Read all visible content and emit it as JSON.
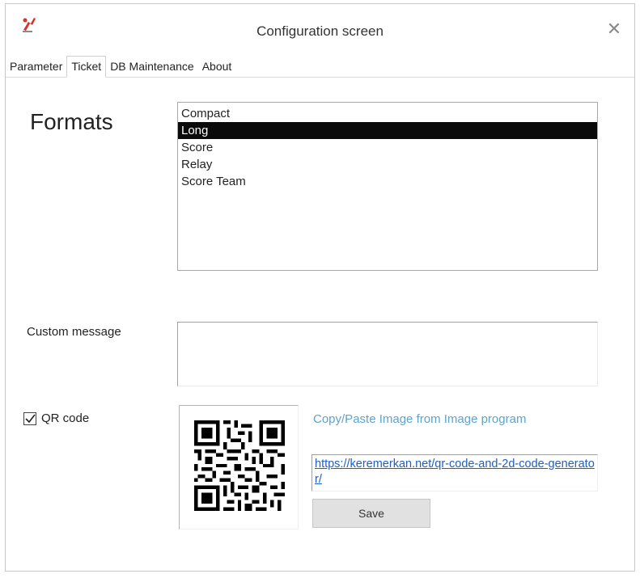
{
  "window": {
    "title": "Configuration screen",
    "close_glyph": "✕",
    "app_icon": "app-logo-icon"
  },
  "tabs": [
    {
      "label": "Parameter",
      "active": false
    },
    {
      "label": "Ticket",
      "active": true
    },
    {
      "label": "DB Maintenance",
      "active": false
    },
    {
      "label": "About",
      "active": false
    }
  ],
  "ticket": {
    "formats_label": "Formats",
    "formats": [
      {
        "label": "Compact",
        "selected": false
      },
      {
        "label": "Long",
        "selected": true
      },
      {
        "label": "Score",
        "selected": false
      },
      {
        "label": "Relay",
        "selected": false
      },
      {
        "label": "Score Team",
        "selected": false
      }
    ],
    "custom_message_label": "Custom message",
    "custom_message_value": "",
    "qr_code_label": "QR code",
    "qr_code_checked": true,
    "paste_hint": "Copy/Paste Image from Image program",
    "qr_url": "https://keremerkan.net/qr-code-and-2d-code-generator/",
    "save_label": "Save"
  },
  "colors": {
    "selection_bg": "#0a0a0a",
    "hint_text": "#5fa3c9",
    "link_text": "#1f5fbf",
    "button_bg": "#e1e1e1"
  }
}
